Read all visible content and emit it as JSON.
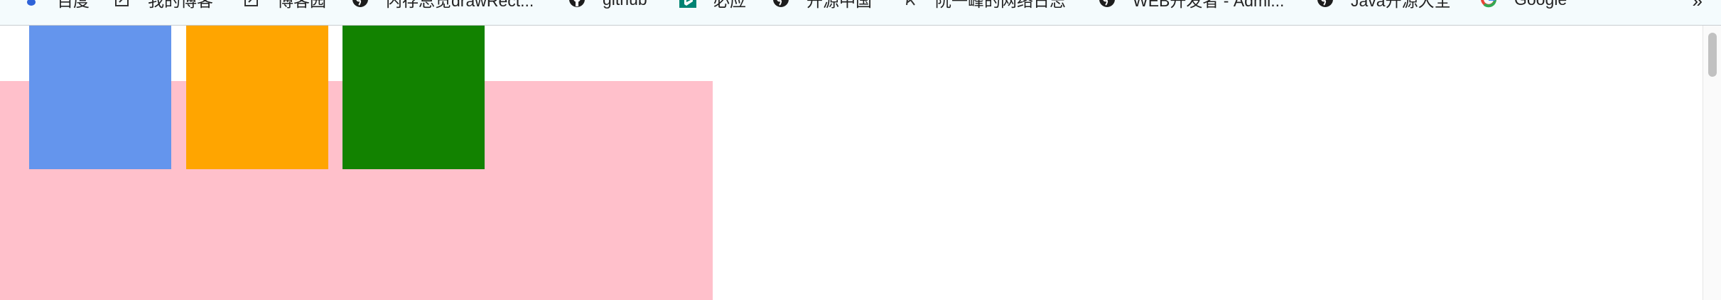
{
  "bookmarks": [
    {
      "label": "百度",
      "icon": "baidu-paw-icon"
    },
    {
      "label": "我的博客",
      "icon": "blog-icon"
    },
    {
      "label": "博客园",
      "icon": "blog-icon"
    },
    {
      "label": "内存总览drawRect...",
      "icon": "globe-icon"
    },
    {
      "label": "github",
      "icon": "github-icon"
    },
    {
      "label": "必应",
      "icon": "bing-icon"
    },
    {
      "label": "开源中国",
      "icon": "globe-icon"
    },
    {
      "label": "阮一峰的网络日志",
      "icon": "ruanyifeng-icon"
    },
    {
      "label": "WEB开发者 - Admi...",
      "icon": "globe-icon"
    },
    {
      "label": "Java开源大全",
      "icon": "globe-icon"
    },
    {
      "label": "Google",
      "icon": "google-icon"
    }
  ],
  "overflow_label": "»",
  "colors": {
    "pink_area": "#ffc0cb",
    "box_blue": "#6495ed",
    "box_orange": "#ffa500",
    "box_green": "#128200"
  }
}
